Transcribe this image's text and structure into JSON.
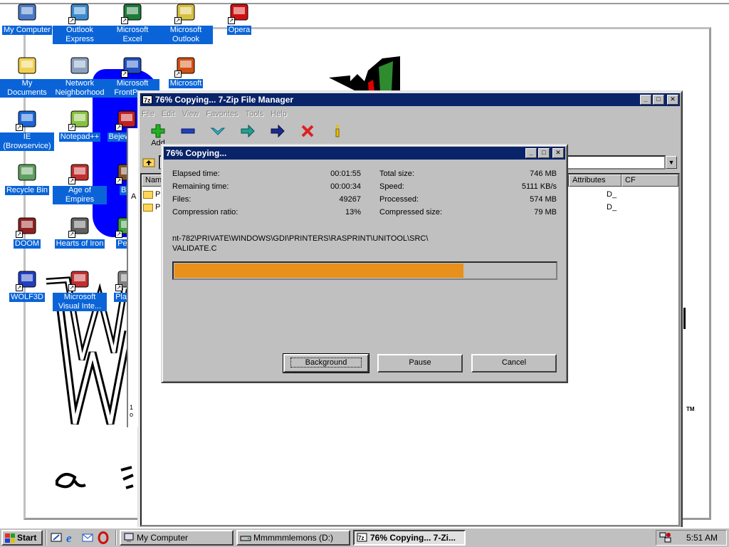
{
  "desktop": {
    "icons": [
      {
        "label": "My Computer",
        "icon": "my-computer-icon"
      },
      {
        "label": "Outlook Express",
        "icon": "outlook-express-icon"
      },
      {
        "label": "Microsoft Excel",
        "icon": "excel-icon"
      },
      {
        "label": "Microsoft Outlook",
        "icon": "outlook-icon"
      },
      {
        "label": "Opera",
        "icon": "opera-icon"
      },
      {
        "label": "My Documents",
        "icon": "my-documents-icon"
      },
      {
        "label": "Network Neighborhood",
        "icon": "network-neighborhood-icon"
      },
      {
        "label": "Microsoft FrontPage",
        "icon": "frontpage-icon"
      },
      {
        "label": "Microsoft",
        "icon": "powerpoint-icon"
      },
      {
        "label": "IE (Browservice)",
        "icon": "ie-icon"
      },
      {
        "label": "Notepad++",
        "icon": "notepadpp-icon"
      },
      {
        "label": "Bejeweled",
        "icon": "bejeweled-icon"
      },
      {
        "label": "Recycle Bin",
        "icon": "recycle-bin-icon"
      },
      {
        "label": "Age of Empires",
        "icon": "age-of-empires-icon"
      },
      {
        "label": "Big",
        "icon": "big-icon"
      },
      {
        "label": "DOOM",
        "icon": "doom-icon"
      },
      {
        "label": "Hearts of Iron",
        "icon": "hearts-of-iron-icon"
      },
      {
        "label": "Pegg",
        "icon": "peggle-icon"
      },
      {
        "label": "WOLF3D",
        "icon": "wolf3d-icon"
      },
      {
        "label": "Microsoft Visual Inte...",
        "icon": "visual-interdev-icon"
      },
      {
        "label": "Pla Zo",
        "icon": "pla-icon"
      }
    ]
  },
  "file_manager": {
    "title": "76% Copying... 7-Zip File Manager",
    "menu": [
      "File",
      "Edit",
      "View",
      "Favorites",
      "Tools",
      "Help"
    ],
    "toolbar": [
      {
        "label": "Add",
        "icon": "add-icon"
      },
      {
        "label": "",
        "icon": "extract-minus-icon"
      },
      {
        "label": "",
        "icon": "test-check-icon"
      },
      {
        "label": "",
        "icon": "copy-arrow-icon"
      },
      {
        "label": "",
        "icon": "move-arrow-icon"
      },
      {
        "label": "",
        "icon": "delete-x-icon"
      },
      {
        "label": "",
        "icon": "info-icon"
      }
    ],
    "columns": {
      "name": "Name",
      "attributes": "Attributes",
      "crc": "CF"
    },
    "rows": [
      {
        "name": "PF",
        "attributes": "D_"
      },
      {
        "name": "PU",
        "attributes": "D_"
      }
    ],
    "side_label": "A",
    "status_fragment": "1 o",
    "tm_mark": "TM"
  },
  "progress": {
    "title": "76% Copying...",
    "elapsed_label": "Elapsed time:",
    "elapsed_value": "00:01:55",
    "remaining_label": "Remaining time:",
    "remaining_value": "00:00:34",
    "files_label": "Files:",
    "files_value": "49267",
    "ratio_label": "Compression ratio:",
    "ratio_value": "13%",
    "total_label": "Total size:",
    "total_value": "746 MB",
    "speed_label": "Speed:",
    "speed_value": "5111 KB/s",
    "processed_label": "Processed:",
    "processed_value": "574 MB",
    "compressed_label": "Compressed size:",
    "compressed_value": "79 MB",
    "current_file_line1": "nt-782\\PRIVATE\\WINDOWS\\GDI\\PRINTERS\\RASPRINT\\UNITOOL\\SRC\\",
    "current_file_line2": "VALIDATE.C",
    "percent": 76,
    "buttons": {
      "background": "Background",
      "pause": "Pause",
      "cancel": "Cancel"
    }
  },
  "taskbar": {
    "start_label": "Start",
    "tasks": [
      {
        "label": "My Computer",
        "active": false
      },
      {
        "label": "Mmmmmlemons (D:)",
        "active": false
      },
      {
        "label": "76% Copying... 7-Zi...",
        "active": true
      }
    ],
    "clock": "5:51 AM"
  },
  "colors": {
    "title_active": "#0a246a",
    "progress_fill": "#e8901c",
    "icon_label_bg": "#0a64d8",
    "face": "#c0c0c0"
  }
}
